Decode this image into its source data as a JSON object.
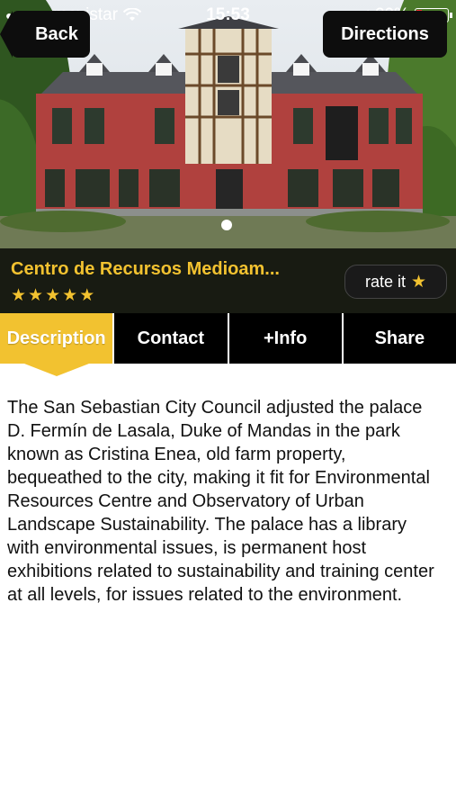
{
  "status_bar": {
    "carrier": "movistar",
    "time": "15:53",
    "battery": "20%",
    "icons": [
      "signal-dots-icon",
      "wifi-icon",
      "location-arrow-icon",
      "battery-icon"
    ]
  },
  "nav": {
    "back_label": "Back",
    "directions_label": "Directions"
  },
  "place": {
    "title": "Centro de Recursos Medioam...",
    "rating": 5,
    "stars_text": "★★★★★",
    "rate_label": "rate it",
    "rate_icon": "★"
  },
  "tabs": [
    {
      "label": "Description",
      "active": true
    },
    {
      "label": "Contact",
      "active": false
    },
    {
      "label": "+Info",
      "active": false
    },
    {
      "label": "Share",
      "active": false
    }
  ],
  "description": "The San Sebastian City Council adjusted the palace D. Fermín de Lasala, Duke of Mandas in the park known as Cristina Enea, old farm property, bequeathed to the city, making it fit for Environmental Resources Centre and Observatory of Urban Landscape Sustainability. The palace has a library with environmental issues, is permanent host exhibitions related to sustainability and training center at all levels, for issues related to the environment.",
  "colors": {
    "accent": "#f2c230",
    "building_wall": "#b0413e",
    "roof": "#4a4a4f",
    "foliage": "#3f6b2a"
  }
}
